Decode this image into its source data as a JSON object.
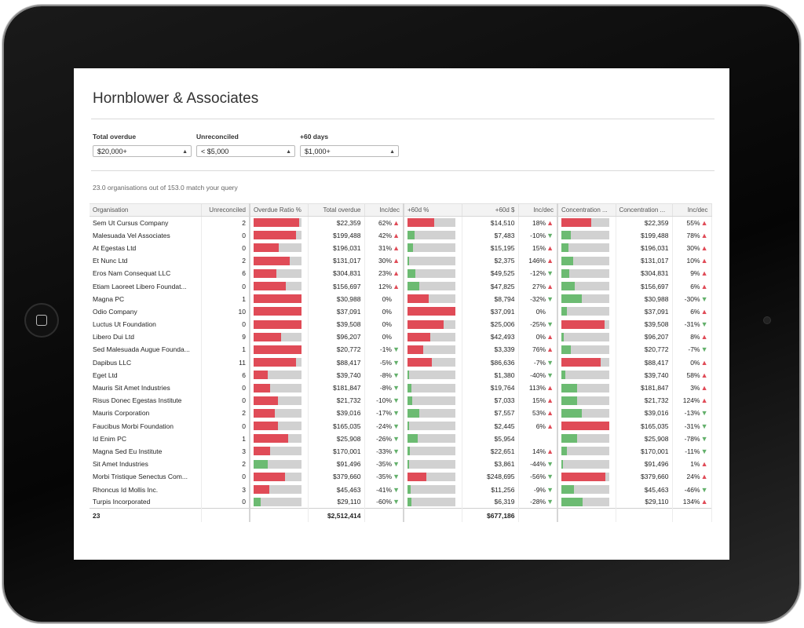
{
  "title": "Hornblower & Associates",
  "filters": [
    {
      "label": "Total overdue",
      "value": "$20,000+"
    },
    {
      "label": "Unreconciled",
      "value": "< $5,000"
    },
    {
      "label": "+60 days",
      "value": "$1,000+"
    }
  ],
  "status": "23.0 organisations out of 153.0 match your query",
  "colors": {
    "red": "#e04b57",
    "green": "#6cbb72",
    "track": "#d1d1d1"
  },
  "columns": [
    "Organisation",
    "Unreconciled",
    "Overdue Ratio %",
    "Total overdue",
    "Inc/dec",
    "+60d %",
    "+60d $",
    "Inc/dec",
    "Concentration ...",
    "Concentration ...",
    "Inc/dec"
  ],
  "rows": [
    {
      "org": "Sem Ut Cursus Company",
      "unrec": "2",
      "ratio": {
        "v": 0.95,
        "c": "red"
      },
      "total": "$22,359",
      "inc1": "62%",
      "d1": "up",
      "p60": {
        "v": 0.55,
        "c": "red"
      },
      "d60": "$14,510",
      "inc2": "18%",
      "d2": "up",
      "conc": {
        "v": 0.63,
        "c": "red"
      },
      "conc_amt": "$22,359",
      "inc3": "55%",
      "d3": "up"
    },
    {
      "org": "Malesuada Vel Associates",
      "unrec": "0",
      "ratio": {
        "v": 0.88,
        "c": "red"
      },
      "total": "$199,488",
      "inc1": "42%",
      "d1": "up",
      "p60": {
        "v": 0.15,
        "c": "green"
      },
      "d60": "$7,483",
      "inc2": "-10%",
      "d2": "down",
      "conc": {
        "v": 0.2,
        "c": "green"
      },
      "conc_amt": "$199,488",
      "inc3": "78%",
      "d3": "up"
    },
    {
      "org": "At Egestas Ltd",
      "unrec": "0",
      "ratio": {
        "v": 0.52,
        "c": "red"
      },
      "total": "$196,031",
      "inc1": "31%",
      "d1": "up",
      "p60": {
        "v": 0.12,
        "c": "green"
      },
      "d60": "$15,195",
      "inc2": "15%",
      "d2": "up",
      "conc": {
        "v": 0.14,
        "c": "green"
      },
      "conc_amt": "$196,031",
      "inc3": "30%",
      "d3": "up"
    },
    {
      "org": "Et Nunc Ltd",
      "unrec": "2",
      "ratio": {
        "v": 0.75,
        "c": "red"
      },
      "total": "$131,017",
      "inc1": "30%",
      "d1": "up",
      "p60": {
        "v": 0.04,
        "c": "green"
      },
      "d60": "$2,375",
      "inc2": "146%",
      "d2": "up",
      "conc": {
        "v": 0.25,
        "c": "green"
      },
      "conc_amt": "$131,017",
      "inc3": "10%",
      "d3": "up"
    },
    {
      "org": "Eros Nam Consequat LLC",
      "unrec": "6",
      "ratio": {
        "v": 0.48,
        "c": "red"
      },
      "total": "$304,831",
      "inc1": "23%",
      "d1": "up",
      "p60": {
        "v": 0.17,
        "c": "green"
      },
      "d60": "$49,525",
      "inc2": "-12%",
      "d2": "down",
      "conc": {
        "v": 0.16,
        "c": "green"
      },
      "conc_amt": "$304,831",
      "inc3": "9%",
      "d3": "up"
    },
    {
      "org": "Etiam Laoreet Libero Foundat...",
      "unrec": "0",
      "ratio": {
        "v": 0.68,
        "c": "red"
      },
      "total": "$156,697",
      "inc1": "12%",
      "d1": "up",
      "p60": {
        "v": 0.25,
        "c": "green"
      },
      "d60": "$47,825",
      "inc2": "27%",
      "d2": "up",
      "conc": {
        "v": 0.28,
        "c": "green"
      },
      "conc_amt": "$156,697",
      "inc3": "6%",
      "d3": "up"
    },
    {
      "org": "Magna PC",
      "unrec": "1",
      "ratio": {
        "v": 1.0,
        "c": "red"
      },
      "total": "$30,988",
      "inc1": "0%",
      "d1": "",
      "p60": {
        "v": 0.45,
        "c": "red"
      },
      "d60": "$8,794",
      "inc2": "-32%",
      "d2": "down",
      "conc": {
        "v": 0.42,
        "c": "green"
      },
      "conc_amt": "$30,988",
      "inc3": "-30%",
      "d3": "down"
    },
    {
      "org": "Odio Company",
      "unrec": "10",
      "ratio": {
        "v": 1.0,
        "c": "red"
      },
      "total": "$37,091",
      "inc1": "0%",
      "d1": "",
      "p60": {
        "v": 1.0,
        "c": "red"
      },
      "d60": "$37,091",
      "inc2": "0%",
      "d2": "",
      "conc": {
        "v": 0.12,
        "c": "green"
      },
      "conc_amt": "$37,091",
      "inc3": "6%",
      "d3": "up"
    },
    {
      "org": "Luctus Ut Foundation",
      "unrec": "0",
      "ratio": {
        "v": 1.0,
        "c": "red"
      },
      "total": "$39,508",
      "inc1": "0%",
      "d1": "",
      "p60": {
        "v": 0.75,
        "c": "red"
      },
      "d60": "$25,006",
      "inc2": "-25%",
      "d2": "down",
      "conc": {
        "v": 0.9,
        "c": "red"
      },
      "conc_amt": "$39,508",
      "inc3": "-31%",
      "d3": "down"
    },
    {
      "org": "Libero Dui Ltd",
      "unrec": "9",
      "ratio": {
        "v": 0.58,
        "c": "red"
      },
      "total": "$96,207",
      "inc1": "0%",
      "d1": "",
      "p60": {
        "v": 0.48,
        "c": "red"
      },
      "d60": "$42,493",
      "inc2": "0%",
      "d2": "up",
      "conc": {
        "v": 0.05,
        "c": "green"
      },
      "conc_amt": "$96,207",
      "inc3": "8%",
      "d3": "up"
    },
    {
      "org": "Sed Malesuada Augue Founda...",
      "unrec": "1",
      "ratio": {
        "v": 1.0,
        "c": "red"
      },
      "total": "$20,772",
      "inc1": "-1%",
      "d1": "down",
      "p60": {
        "v": 0.33,
        "c": "red"
      },
      "d60": "$3,339",
      "inc2": "76%",
      "d2": "up",
      "conc": {
        "v": 0.2,
        "c": "green"
      },
      "conc_amt": "$20,772",
      "inc3": "-7%",
      "d3": "down"
    },
    {
      "org": "Dapibus LLC",
      "unrec": "11",
      "ratio": {
        "v": 0.88,
        "c": "red"
      },
      "total": "$88,417",
      "inc1": "-5%",
      "d1": "down",
      "p60": {
        "v": 0.5,
        "c": "red"
      },
      "d60": "$86,636",
      "inc2": "-7%",
      "d2": "down",
      "conc": {
        "v": 0.82,
        "c": "red"
      },
      "conc_amt": "$88,417",
      "inc3": "0%",
      "d3": "up"
    },
    {
      "org": "Eget Ltd",
      "unrec": "6",
      "ratio": {
        "v": 0.3,
        "c": "red"
      },
      "total": "$39,740",
      "inc1": "-8%",
      "d1": "down",
      "p60": {
        "v": 0.03,
        "c": "green"
      },
      "d60": "$1,380",
      "inc2": "-40%",
      "d2": "down",
      "conc": {
        "v": 0.08,
        "c": "green"
      },
      "conc_amt": "$39,740",
      "inc3": "58%",
      "d3": "up"
    },
    {
      "org": "Mauris Sit Amet Industries",
      "unrec": "0",
      "ratio": {
        "v": 0.35,
        "c": "red"
      },
      "total": "$181,847",
      "inc1": "-8%",
      "d1": "down",
      "p60": {
        "v": 0.08,
        "c": "green"
      },
      "d60": "$19,764",
      "inc2": "113%",
      "d2": "up",
      "conc": {
        "v": 0.33,
        "c": "green"
      },
      "conc_amt": "$181,847",
      "inc3": "3%",
      "d3": "up"
    },
    {
      "org": "Risus Donec Egestas Institute",
      "unrec": "0",
      "ratio": {
        "v": 0.5,
        "c": "red"
      },
      "total": "$21,732",
      "inc1": "-10%",
      "d1": "down",
      "p60": {
        "v": 0.1,
        "c": "green"
      },
      "d60": "$7,033",
      "inc2": "15%",
      "d2": "up",
      "conc": {
        "v": 0.32,
        "c": "green"
      },
      "conc_amt": "$21,732",
      "inc3": "124%",
      "d3": "up"
    },
    {
      "org": "Mauris Corporation",
      "unrec": "2",
      "ratio": {
        "v": 0.45,
        "c": "red"
      },
      "total": "$39,016",
      "inc1": "-17%",
      "d1": "down",
      "p60": {
        "v": 0.25,
        "c": "green"
      },
      "d60": "$7,557",
      "inc2": "53%",
      "d2": "up",
      "conc": {
        "v": 0.42,
        "c": "green"
      },
      "conc_amt": "$39,016",
      "inc3": "-13%",
      "d3": "down"
    },
    {
      "org": "Faucibus Morbi Foundation",
      "unrec": "0",
      "ratio": {
        "v": 0.5,
        "c": "red"
      },
      "total": "$165,035",
      "inc1": "-24%",
      "d1": "down",
      "p60": {
        "v": 0.03,
        "c": "green"
      },
      "d60": "$2,445",
      "inc2": "6%",
      "d2": "up",
      "conc": {
        "v": 1.0,
        "c": "red"
      },
      "conc_amt": "$165,035",
      "inc3": "-31%",
      "d3": "down"
    },
    {
      "org": "Id Enim PC",
      "unrec": "1",
      "ratio": {
        "v": 0.72,
        "c": "red"
      },
      "total": "$25,908",
      "inc1": "-26%",
      "d1": "down",
      "p60": {
        "v": 0.22,
        "c": "green"
      },
      "d60": "$5,954",
      "inc2": "",
      "d2": "",
      "conc": {
        "v": 0.33,
        "c": "green"
      },
      "conc_amt": "$25,908",
      "inc3": "-78%",
      "d3": "down"
    },
    {
      "org": "Magna Sed Eu Institute",
      "unrec": "3",
      "ratio": {
        "v": 0.35,
        "c": "red"
      },
      "total": "$170,001",
      "inc1": "-33%",
      "d1": "down",
      "p60": {
        "v": 0.05,
        "c": "green"
      },
      "d60": "$22,651",
      "inc2": "14%",
      "d2": "up",
      "conc": {
        "v": 0.12,
        "c": "green"
      },
      "conc_amt": "$170,001",
      "inc3": "-11%",
      "d3": "down"
    },
    {
      "org": "Sit Amet Industries",
      "unrec": "2",
      "ratio": {
        "v": 0.3,
        "c": "green"
      },
      "total": "$91,496",
      "inc1": "-35%",
      "d1": "down",
      "p60": {
        "v": 0.03,
        "c": "green"
      },
      "d60": "$3,861",
      "inc2": "-44%",
      "d2": "down",
      "conc": {
        "v": 0.04,
        "c": "green"
      },
      "conc_amt": "$91,496",
      "inc3": "1%",
      "d3": "up"
    },
    {
      "org": "Morbi Tristique Senectus Com...",
      "unrec": "0",
      "ratio": {
        "v": 0.65,
        "c": "red"
      },
      "total": "$379,660",
      "inc1": "-35%",
      "d1": "down",
      "p60": {
        "v": 0.4,
        "c": "red"
      },
      "d60": "$248,695",
      "inc2": "-56%",
      "d2": "down",
      "conc": {
        "v": 0.92,
        "c": "red"
      },
      "conc_amt": "$379,660",
      "inc3": "24%",
      "d3": "up"
    },
    {
      "org": "Rhoncus Id Mollis Inc.",
      "unrec": "3",
      "ratio": {
        "v": 0.32,
        "c": "red"
      },
      "total": "$45,463",
      "inc1": "-41%",
      "d1": "down",
      "p60": {
        "v": 0.07,
        "c": "green"
      },
      "d60": "$11,256",
      "inc2": "-9%",
      "d2": "down",
      "conc": {
        "v": 0.26,
        "c": "green"
      },
      "conc_amt": "$45,463",
      "inc3": "-46%",
      "d3": "down"
    },
    {
      "org": "Turpis Incorporated",
      "unrec": "0",
      "ratio": {
        "v": 0.14,
        "c": "green"
      },
      "total": "$29,110",
      "inc1": "-60%",
      "d1": "down",
      "p60": {
        "v": 0.08,
        "c": "green"
      },
      "d60": "$6,319",
      "inc2": "-28%",
      "d2": "down",
      "conc": {
        "v": 0.45,
        "c": "green"
      },
      "conc_amt": "$29,110",
      "inc3": "134%",
      "d3": "up"
    }
  ],
  "footer": {
    "count": "23",
    "total_overdue": "$2,512,414",
    "total_60d": "$677,186"
  }
}
